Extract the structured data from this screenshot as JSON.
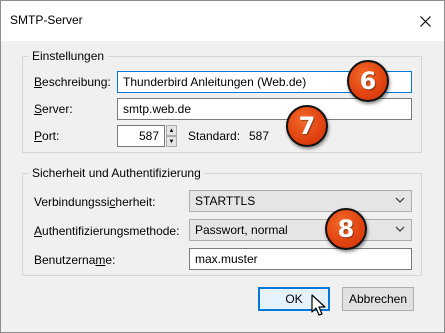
{
  "window": {
    "title": "SMTP-Server"
  },
  "settings": {
    "group_title": "Einstellungen",
    "description_label_u": "B",
    "description_label_rest": "eschreibung:",
    "description_value": "Thunderbird Anleitungen (Web.de)",
    "server_label_u": "S",
    "server_label_rest": "erver:",
    "server_value": "smtp.web.de",
    "port_label_u": "P",
    "port_label_rest": "ort:",
    "port_value": "587",
    "standard_label": "Standard:",
    "standard_value": "587"
  },
  "security": {
    "group_title": "Sicherheit und Authentifizierung",
    "connection_label_pre": "Verbindungssi",
    "connection_label_u": "c",
    "connection_label_post": "herheit:",
    "connection_value": "STARTTLS",
    "auth_label_u": "A",
    "auth_label_rest": "uthentifizierungsmethode:",
    "auth_value": "Passwort, normal",
    "username_label_pre": "Benutzerna",
    "username_label_u": "m",
    "username_label_post": "e:",
    "username_value": "max.muster"
  },
  "buttons": {
    "ok": "OK",
    "cancel": "Abbrechen"
  },
  "badges": [
    "6",
    "7",
    "8"
  ],
  "colors": {
    "badge": "#e0410f",
    "focus": "#0078d7",
    "dialog_bg": "#f0f0f0"
  }
}
